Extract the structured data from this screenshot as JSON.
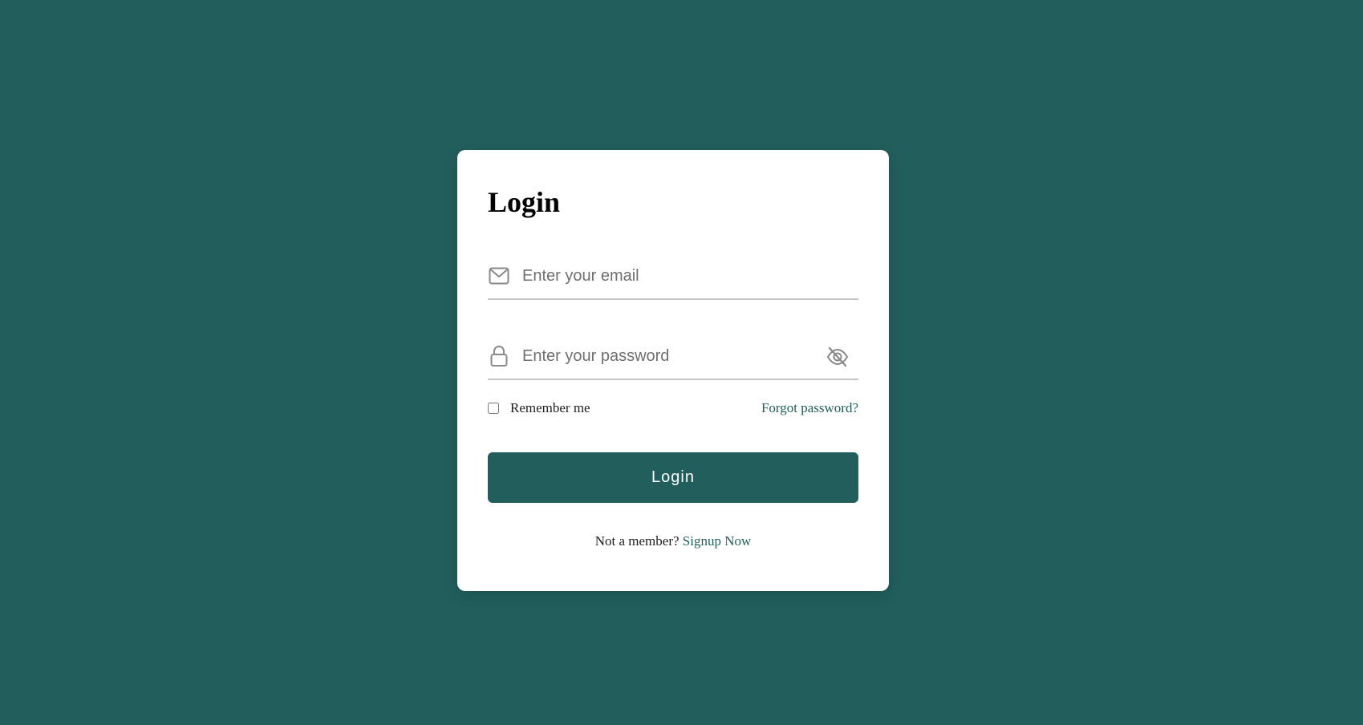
{
  "colors": {
    "background": "#215e5c",
    "card": "#ffffff",
    "accent": "#215e5c",
    "button_text": "#ffffff",
    "input_underline": "#c4c4c4",
    "icon": "#8a8a8a"
  },
  "login_form": {
    "title": "Login",
    "email": {
      "icon": "envelope-icon",
      "placeholder": "Enter your email",
      "value": ""
    },
    "password": {
      "icon": "lock-icon",
      "placeholder": "Enter your password",
      "value": "",
      "toggle_icon": "eye-slash-icon"
    },
    "remember_me": {
      "label": "Remember me",
      "checked": false
    },
    "forgot_password_label": "Forgot password?",
    "submit_label": "Login",
    "signup_prompt": "Not a member?",
    "signup_link_label": "Signup Now"
  }
}
